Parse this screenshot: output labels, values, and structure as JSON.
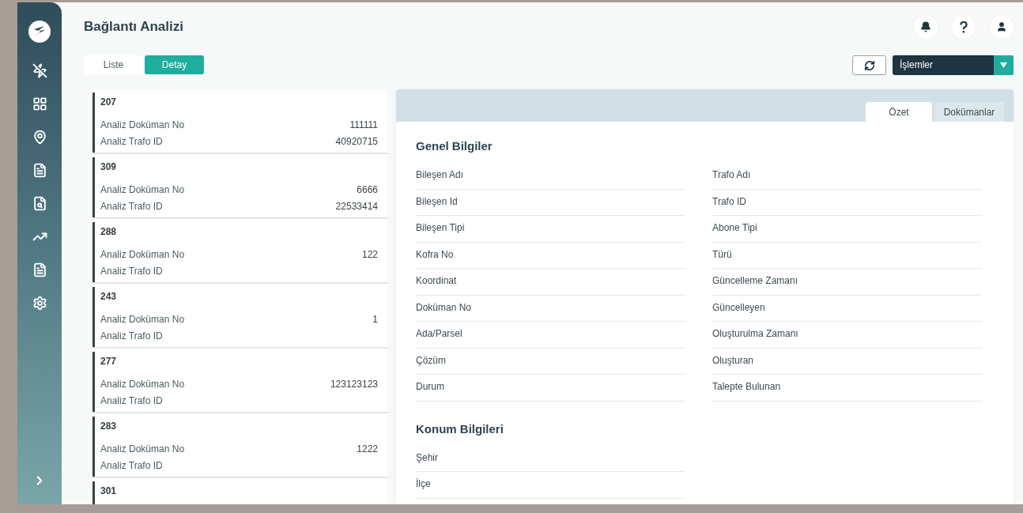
{
  "page": {
    "title": "Bağlantı Analizi"
  },
  "view_toggle": [
    {
      "label": "Liste",
      "selected": false
    },
    {
      "label": "Detay",
      "selected": true
    }
  ],
  "actions": {
    "dropdown": "İşlemler"
  },
  "records": [
    {
      "id": "207",
      "fields": [
        {
          "label": "Analiz Doküman No",
          "value": "111111"
        },
        {
          "label": "Analiz Trafo ID",
          "value": "40920715"
        }
      ]
    },
    {
      "id": "309",
      "fields": [
        {
          "label": "Analiz Doküman No",
          "value": "6666"
        },
        {
          "label": "Analiz Trafo ID",
          "value": "22533414"
        }
      ]
    },
    {
      "id": "288",
      "fields": [
        {
          "label": "Analiz Doküman No",
          "value": "122"
        },
        {
          "label": "Analiz Trafo ID"
        }
      ]
    },
    {
      "id": "243",
      "fields": [
        {
          "label": "Analiz Doküman No",
          "value": "1"
        },
        {
          "label": "Analiz Trafo ID"
        }
      ]
    },
    {
      "id": "277",
      "fields": [
        {
          "label": "Analiz Doküman No",
          "value": "123123123"
        },
        {
          "label": "Analiz Trafo ID"
        }
      ]
    },
    {
      "id": "283",
      "fields": [
        {
          "label": "Analiz Doküman No",
          "value": "1222"
        },
        {
          "label": "Analiz Trafo ID"
        }
      ]
    },
    {
      "id": "301"
    }
  ],
  "detail": {
    "tabs": [
      {
        "label": "Özet",
        "selected": true
      },
      {
        "label": "Dokümanlar",
        "selected": false
      }
    ],
    "sections": [
      {
        "title": "Genel Bilgiler",
        "columns": [
          [
            "Bileşen Adı",
            "Bileşen Id",
            "Bileşen Tipi",
            "Kofra No",
            "Koordinat",
            "Doküman No",
            "Ada/Parsel",
            "Çözüm",
            "Durum"
          ],
          [
            "Trafo Adı",
            "Trafo ID",
            "Abone Tipi",
            "Türü",
            "Güncelleme Zamanı",
            "Güncelleyen",
            "Oluşturulma Zamanı",
            "Oluşturan",
            "Talepte Bulunan"
          ]
        ]
      },
      {
        "title": "Konum Bilgileri",
        "columns": [
          [
            "Şehir",
            "İlçe"
          ]
        ]
      }
    ]
  }
}
